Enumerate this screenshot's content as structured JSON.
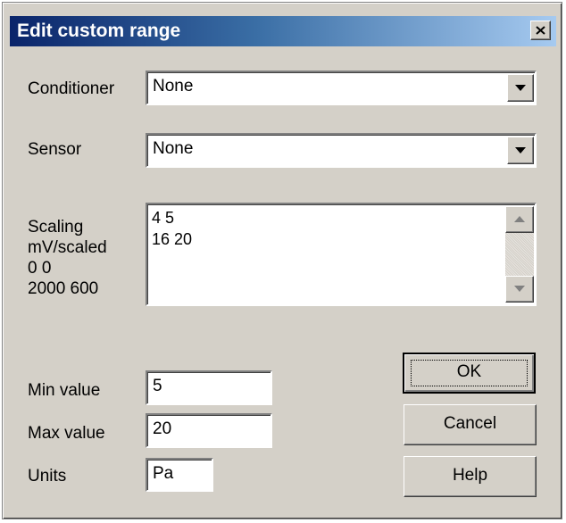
{
  "window": {
    "title": "Edit custom range",
    "close_icon": "close-icon"
  },
  "conditioner": {
    "label": "Conditioner",
    "value": "None"
  },
  "sensor": {
    "label": "Sensor",
    "value": "None"
  },
  "scaling": {
    "label_lines": [
      "Scaling",
      "mV/scaled",
      "0 0",
      "2000 600"
    ],
    "content_lines": [
      "4 5",
      "16 20"
    ]
  },
  "min_value": {
    "label": "Min value",
    "value": "5"
  },
  "max_value": {
    "label": "Max value",
    "value": "20"
  },
  "units": {
    "label": "Units",
    "value": "Pa"
  },
  "buttons": {
    "ok": "OK",
    "cancel": "Cancel",
    "help": "Help"
  },
  "colors": {
    "title_start": "#0a246a",
    "title_end": "#a6caf0",
    "face": "#d4d0c8"
  }
}
